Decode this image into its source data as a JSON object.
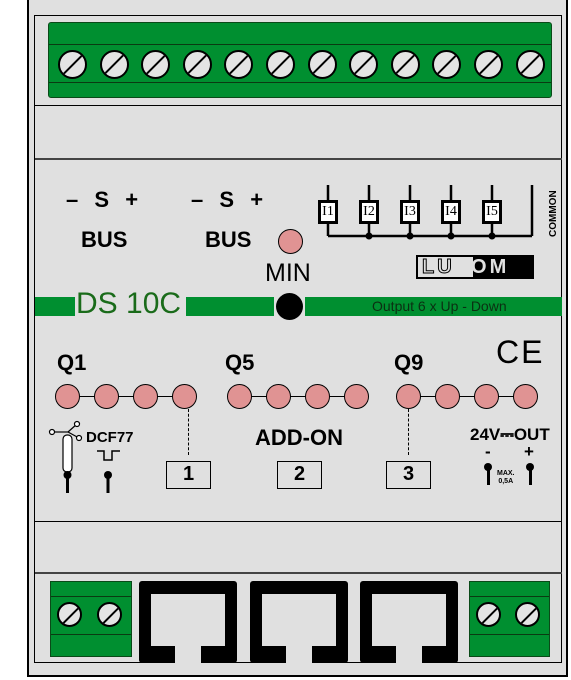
{
  "device": {
    "model": "DS 10C",
    "brand": "LUXOM",
    "description": "Output  6  x  Up - Down",
    "ce_mark": "CE"
  },
  "top_terminal_block": {
    "screw_count": 12,
    "color": "#008f30"
  },
  "bus": [
    {
      "polarity": [
        "–",
        "S",
        "+"
      ],
      "label": "BUS"
    },
    {
      "polarity": [
        "–",
        "S",
        "+"
      ],
      "label": "BUS"
    }
  ],
  "min_indicator": {
    "label": "MIN",
    "led_color": "#e09393"
  },
  "inputs": {
    "labels": [
      "I1",
      "I2",
      "I3",
      "I4",
      "I5"
    ],
    "common_label": "COMMON"
  },
  "outputs": {
    "groups": [
      {
        "label": "Q1",
        "leds": 4
      },
      {
        "label": "Q5",
        "leds": 4
      },
      {
        "label": "Q9",
        "leds": 4
      }
    ],
    "led_color": "#e09393"
  },
  "sensors": {
    "wind_icon": "anemometer-icon",
    "dcf_label": "DCF77"
  },
  "addon": {
    "label": "ADD-ON",
    "ports": [
      "1",
      "2",
      "3"
    ]
  },
  "power_out": {
    "label": "24V",
    "dc_symbol": "⎓",
    "out_label": "OUT",
    "minus": "-",
    "plus": "+",
    "max_label": "MAX.",
    "max_value": "0,5A"
  },
  "bottom": {
    "left_screws": 2,
    "right_screws": 2,
    "rj45_ports": 3
  }
}
